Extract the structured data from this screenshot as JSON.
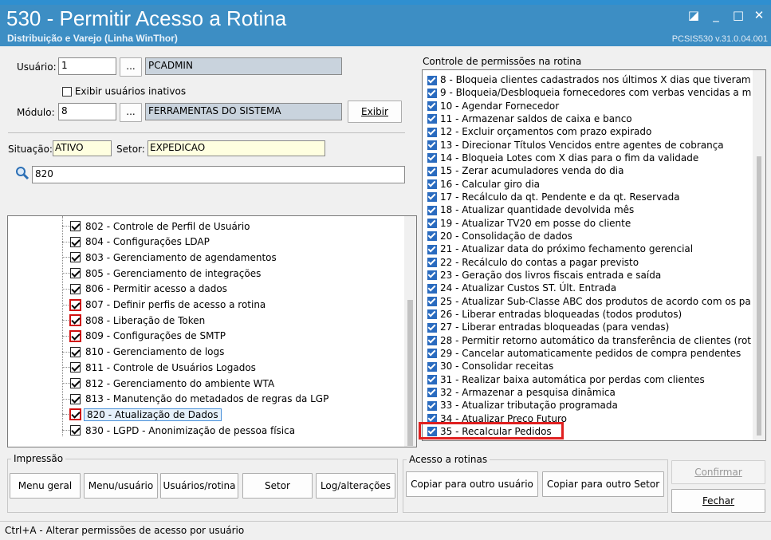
{
  "window": {
    "title": "530 - Permitir Acesso a Rotina",
    "subtitle": "Distribuição e Varejo (Linha WinThor)",
    "version": "PCSIS530  v.31.0.04.001"
  },
  "form": {
    "usuario_label": "Usuário:",
    "usuario_value": "1",
    "usuario_name": "PCADMIN",
    "lookup_button": "...",
    "show_inactive_label": "Exibir usuários inativos",
    "modulo_label": "Módulo:",
    "modulo_value": "8",
    "modulo_name": "FERRAMENTAS DO SISTEMA",
    "exibir_button": "Exibir",
    "situacao_label": "Situação:",
    "situacao_value": "ATIVO",
    "setor_label": "Setor:",
    "setor_value": "EXPEDICAO",
    "search_value": "820"
  },
  "tree": {
    "items": [
      {
        "label": "802 - Controle de Perfil de Usuário",
        "red": false
      },
      {
        "label": "804 - Configurações LDAP",
        "red": false
      },
      {
        "label": "803 - Gerenciamento de agendamentos",
        "red": false
      },
      {
        "label": "805 - Gerenciamento de integrações",
        "red": false
      },
      {
        "label": "806 - Permitir acesso a dados",
        "red": false
      },
      {
        "label": "807 - Definir perfis de acesso a rotina",
        "red": true
      },
      {
        "label": "808 - Liberação de Token",
        "red": true
      },
      {
        "label": "809 - Configurações de SMTP",
        "red": true
      },
      {
        "label": "810 - Gerenciamento de logs",
        "red": false
      },
      {
        "label": "811 - Controle de Usuários Logados",
        "red": false
      },
      {
        "label": "812 - Gerenciamento do ambiente WTA",
        "red": false
      },
      {
        "label": "813 - Manutenção do metadados de regras da LGP",
        "red": false
      },
      {
        "label": "820 - Atualização de Dados",
        "red": true
      },
      {
        "label": "830 - LGPD - Anonimização de pessoa física",
        "red": false
      }
    ]
  },
  "permissions": {
    "title": "Controle de permissões na rotina",
    "items": [
      "8 - Bloqueia clientes cadastrados nos últimos X dias que tiveram d",
      "9 - Bloqueia/Desbloqueia fornecedores com verbas vencidas a m",
      "10 - Agendar Fornecedor",
      "11 - Armazenar saldos de caixa e banco",
      "12 - Excluir orçamentos com prazo expirado",
      "13 - Direcionar Títulos Vencidos entre agentes de cobrança",
      "14 - Bloqueia Lotes com X dias para o fim da validade",
      "15 - Zerar acumuladores venda do dia",
      "16 - Calcular giro dia",
      "17 - Recálculo da qt. Pendente e da qt. Reservada",
      "18 - Atualizar quantidade devolvida mês",
      "19 - Atualizar TV20 em posse do cliente",
      "20 - Consolidação de dados",
      "21 - Atualizar data do próximo fechamento gerencial",
      "22 - Recálculo do contas a pagar previsto",
      "23 - Geração dos livros fiscais entrada e saída",
      "24 - Atualizar Custos ST. Últ. Entrada",
      "25 - Atualizar Sub-Classe ABC dos produtos de acordo com os pa",
      "26 - Liberar entradas bloqueadas (todos produtos)",
      "27 - Liberar entradas bloqueadas (para vendas)",
      "28 - Permitir retorno automático da transferência de clientes (rot",
      "29 - Cancelar automaticamente pedidos de compra pendentes",
      "30 - Consolidar receitas",
      "31 - Realizar baixa automática por perdas com clientes",
      "32 - Armazenar a pesquisa dinâmica",
      "33 - Atualizar tributação programada",
      "34 - Atualizar Preço Futuro",
      "35 - Recalcular Pedidos"
    ]
  },
  "impressao": {
    "title": "Impressão",
    "buttons": [
      "Menu geral",
      "Menu/usuário",
      "Usuários/rotina",
      "Setor",
      "Log/alterações"
    ]
  },
  "acesso": {
    "title": "Acesso a rotinas",
    "copy_user": "Copiar para outro usuário",
    "copy_setor": "Copiar para outro Setor"
  },
  "actions": {
    "confirmar": "Confirmar",
    "fechar": "Fechar"
  },
  "statusbar": "Ctrl+A - Alterar permissões de acesso por usuário"
}
